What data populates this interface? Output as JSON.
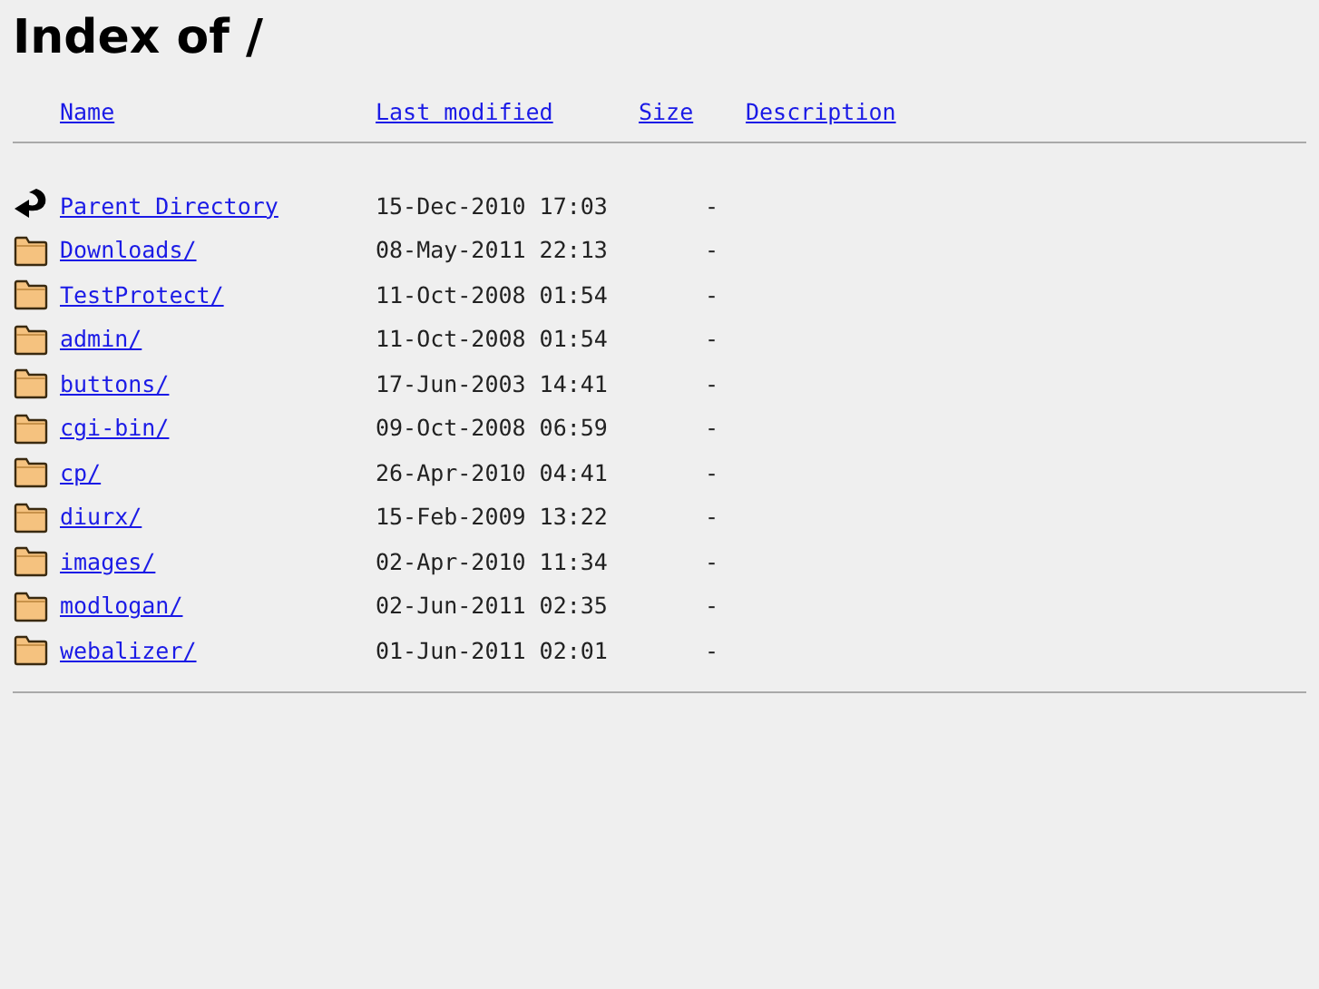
{
  "title": "Index of /",
  "columns": [
    "Name",
    "Last modified",
    "Size",
    "Description"
  ],
  "rows": [
    {
      "kind": "parent",
      "name": "Parent Directory",
      "modified": "15-Dec-2010 17:03",
      "size": "-"
    },
    {
      "kind": "folder",
      "name": "Downloads/",
      "modified": "08-May-2011 22:13",
      "size": "-"
    },
    {
      "kind": "folder",
      "name": "TestProtect/",
      "modified": "11-Oct-2008 01:54",
      "size": "-"
    },
    {
      "kind": "folder",
      "name": "admin/",
      "modified": "11-Oct-2008 01:54",
      "size": "-"
    },
    {
      "kind": "folder",
      "name": "buttons/",
      "modified": "17-Jun-2003 14:41",
      "size": "-"
    },
    {
      "kind": "folder",
      "name": "cgi-bin/",
      "modified": "09-Oct-2008 06:59",
      "size": "-"
    },
    {
      "kind": "folder",
      "name": "cp/",
      "modified": "26-Apr-2010 04:41",
      "size": "-"
    },
    {
      "kind": "folder",
      "name": "diurx/",
      "modified": "15-Feb-2009 13:22",
      "size": "-"
    },
    {
      "kind": "folder",
      "name": "images/",
      "modified": "02-Apr-2010 11:34",
      "size": "-"
    },
    {
      "kind": "folder",
      "name": "modlogan/",
      "modified": "02-Jun-2011 02:35",
      "size": "-"
    },
    {
      "kind": "folder",
      "name": "webalizer/",
      "modified": "01-Jun-2011 02:01",
      "size": "-"
    }
  ]
}
